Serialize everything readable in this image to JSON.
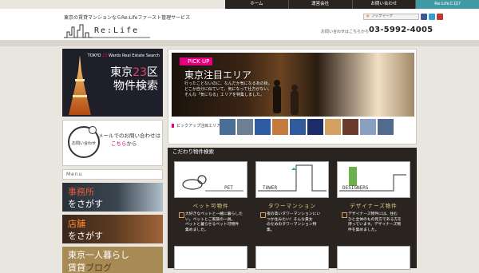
{
  "topnav": {
    "items": [
      {
        "label": "ホーム"
      },
      {
        "label": "運営会社"
      },
      {
        "label": "お問い合わせ"
      },
      {
        "label": "Re:Lifeとは?"
      }
    ]
  },
  "header": {
    "tagline": "東京の賃貸マンションならRe:Lifeファースト管理サービス",
    "logo_text": "Re:Life",
    "bookmark_label": "ブックマーク",
    "phone_label": "お問い合わせはこちらから",
    "phone": "03-5992-4005"
  },
  "sidebar": {
    "tokyo_banner": {
      "small_prefix": "TOKYO",
      "small_accent": "23",
      "small_suffix": "Wards Real Estate Search",
      "big_prefix": "東京",
      "big_accent": "23",
      "big_suffix": "区",
      "big_line2": "物件検索"
    },
    "contact": {
      "circle_label": "お問い合わせ",
      "line1": "メールでのお問い合わせは",
      "link": "こちら",
      "line2_suffix": "から"
    },
    "menu_head": "Menu",
    "banners": [
      {
        "line1": "事務所",
        "line2": "をさがす"
      },
      {
        "line1": "店舗",
        "line2": "をさがす"
      },
      {
        "line1": "東京一人暮らし",
        "line2_prefix": "賃貸",
        "line2_accent": "ブログ"
      }
    ]
  },
  "hero": {
    "badge": "PICK UP",
    "title": "東京注目エリア",
    "desc": [
      "行ったことないのに、なんだか気になるあの街。",
      "どこか自分に似ていて、気になって仕方がない。",
      "そんな「気になる」エリアを特集しました。"
    ],
    "thumb_label": "ピックアップ注目エリア",
    "thumb_colors": [
      "#4a6f96",
      "#6d7f92",
      "#2d5aa0",
      "#c47a3c",
      "#305a9a",
      "#1c2c6a",
      "#d4a060",
      "#6a3a2a",
      "#8aa0c0",
      "#506a90"
    ]
  },
  "search": {
    "heading": "こだわり物件検索",
    "cards": [
      {
        "img_label": "PET",
        "title": "ペット可物件",
        "desc": [
          "大好きなペットと一緒に暮らした",
          "い。ペットとご家族の一員。",
          "ペットと暮らせるペット可物件",
          "集めました。"
        ]
      },
      {
        "img_label": "TOWER",
        "title": "タワーマンション",
        "desc": [
          "夜の高いタワーマンションにい",
          "つか住みたい！そんな貴女",
          "のためのタワーマンション特",
          "集。"
        ]
      },
      {
        "img_label": "DESIGNERS",
        "title": "デザイナーズ物件",
        "desc": [
          "デザイナーズ物件には、住む",
          "ひと全体のもの見方である方を",
          "持っています。デザイナーズ物",
          "件を集めました。"
        ]
      }
    ]
  },
  "colors": {
    "brand_dark": "#2a2421",
    "accent_pink": "#e3007f",
    "accent_teal": "#3f9aa5",
    "background": "#e9e6df"
  }
}
